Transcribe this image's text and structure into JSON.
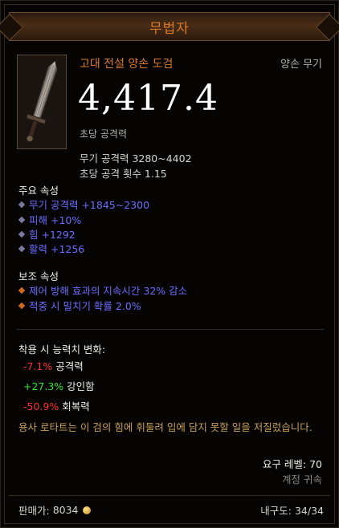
{
  "header": {
    "title": "무법자"
  },
  "item": {
    "name": "고대 전설 양손 도검",
    "type": "양손 무기",
    "dps": "4,417.4",
    "dps_label": "초당 공격력",
    "weapon_damage": "무기 공격력 3280~4402",
    "attack_speed": "초당 공격 횟수 1.15"
  },
  "primary": {
    "title": "주요 속성",
    "affixes": [
      "무기 공격력 +1845~2300",
      "피해 +10%",
      "힘 +1292",
      "활력 +1256"
    ]
  },
  "secondary": {
    "title": "보조 속성",
    "affixes": [
      "제어 방해 효과의 지속시간 32% 감소",
      "적중 시 밀치기 확률 2.0%"
    ]
  },
  "changes": {
    "title": "착용 시 능력치 변화:",
    "rows": [
      {
        "value": "-7.1%",
        "label": "공격력"
      },
      {
        "value": "+27.3%",
        "label": "강인함"
      },
      {
        "value": "-50.9%",
        "label": "회복력"
      }
    ]
  },
  "flavor": "용사 로타트는 이 검의 힘에 휘둘려 입에 담지 못할 일을 저질렀습니다.",
  "requirements": {
    "level": "요구 레벨: 70",
    "bound": "계정 귀속"
  },
  "footer": {
    "sell_label": "판매가:",
    "sell_value": "8034",
    "durability": "내구도: 34/34"
  },
  "colors": {
    "legendary": "#d97a2a",
    "magic": "#6d6cff",
    "negative": "#ff3030",
    "positive": "#30e030",
    "flavor": "#c9a05a"
  },
  "icons": [
    "sword-icon",
    "gold-coin-icon"
  ]
}
